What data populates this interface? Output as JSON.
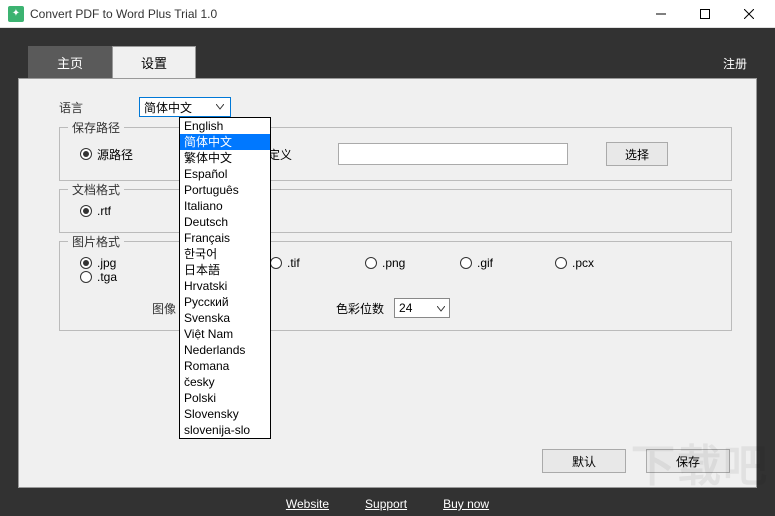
{
  "window": {
    "title": "Convert PDF to Word Plus Trial 1.0"
  },
  "tabs": {
    "home": "主页",
    "settings": "设置",
    "register": "注册"
  },
  "labels": {
    "language": "语言",
    "save_path": "保存路径",
    "doc_format": "文档格式",
    "img_format": "图片格式",
    "image_prefix": "图像",
    "color_bits": "色彩位数"
  },
  "language": {
    "selected": "简体中文",
    "options": [
      "English",
      "简体中文",
      "繁体中文",
      "Español",
      "Português",
      "Italiano",
      "Deutsch",
      "Français",
      "한국어",
      "日本語",
      "Hrvatski",
      "Русский",
      "Svenska",
      "Việt Nam",
      "Nederlands",
      "Romana",
      "česky",
      "Polski",
      "Slovensky",
      "slovenija-slo"
    ],
    "highlight_index": 1
  },
  "save_path": {
    "source": "源路径",
    "custom": "自定义",
    "browse": "选择"
  },
  "doc_format": {
    "rtf": ".rtf"
  },
  "img_format": {
    "jpg": ".jpg",
    "tif": ".tif",
    "png": ".png",
    "gif": ".gif",
    "pcx": ".pcx",
    "tga": ".tga"
  },
  "color_bits_value": "24",
  "buttons": {
    "default": "默认",
    "save": "保存"
  },
  "footer": {
    "website": "Website",
    "support": "Support",
    "buynow": "Buy now"
  },
  "watermark": "下载吧"
}
